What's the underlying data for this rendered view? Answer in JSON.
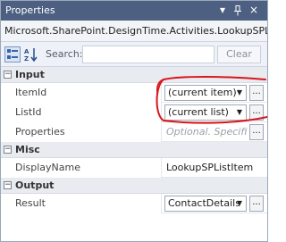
{
  "window": {
    "title": "Properties"
  },
  "titlebar": {
    "dropdown_icon": "▾",
    "pin_icon": "ᵖ",
    "close_icon": "×"
  },
  "object_name": "Microsoft.SharePoint.DesignTime.Activities.LookupSPListI...",
  "toolbar": {
    "search_label": "Search:",
    "search_value": "",
    "clear_label": "Clear"
  },
  "categories": {
    "input": {
      "label": "Input",
      "toggle": "⊟",
      "item_id": {
        "name": "ItemId",
        "value": "(current item)"
      },
      "list_id": {
        "name": "ListId",
        "value": "(current list)"
      },
      "properties": {
        "name": "Properties",
        "value": "Optional. Specifico"
      }
    },
    "misc": {
      "label": "Misc",
      "toggle": "⊟",
      "display_name": {
        "name": "DisplayName",
        "value": "LookupSPListItem"
      }
    },
    "output": {
      "label": "Output",
      "toggle": "⊟",
      "result": {
        "name": "Result",
        "value": "ContactDetails"
      }
    }
  },
  "colors": {
    "titlebar": "#4d6082",
    "annotation": "#d9161c"
  }
}
